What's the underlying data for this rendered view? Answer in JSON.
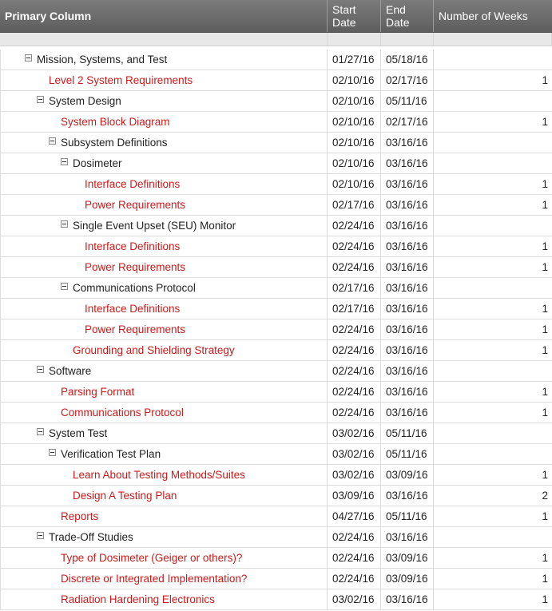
{
  "colors": {
    "task_text": "#cc1a1a",
    "group_text": "#222222",
    "header_bg": "#6b6b6b"
  },
  "header": {
    "primary": "Primary Column",
    "start": "Start\nDate",
    "end": "End\nDate",
    "weeks": "Number of Weeks"
  },
  "rows": [
    {
      "name": "Mission, Systems, and Test",
      "level": 0,
      "group": true,
      "start": "01/27/16",
      "end": "05/18/16",
      "weeks": ""
    },
    {
      "name": "Level 2 System Requirements",
      "level": 1,
      "group": false,
      "start": "02/10/16",
      "end": "02/17/16",
      "weeks": "1"
    },
    {
      "name": "System Design",
      "level": 1,
      "group": true,
      "start": "02/10/16",
      "end": "05/11/16",
      "weeks": ""
    },
    {
      "name": "System Block Diagram",
      "level": 2,
      "group": false,
      "start": "02/10/16",
      "end": "02/17/16",
      "weeks": "1"
    },
    {
      "name": "Subsystem Definitions",
      "level": 2,
      "group": true,
      "start": "02/10/16",
      "end": "03/16/16",
      "weeks": ""
    },
    {
      "name": "Dosimeter",
      "level": 3,
      "group": true,
      "start": "02/10/16",
      "end": "03/16/16",
      "weeks": ""
    },
    {
      "name": "Interface Definitions",
      "level": 4,
      "group": false,
      "start": "02/10/16",
      "end": "03/16/16",
      "weeks": "1"
    },
    {
      "name": "Power Requirements",
      "level": 4,
      "group": false,
      "start": "02/17/16",
      "end": "03/16/16",
      "weeks": "1"
    },
    {
      "name": "Single Event Upset (SEU) Monitor",
      "level": 3,
      "group": true,
      "start": "02/24/16",
      "end": "03/16/16",
      "weeks": ""
    },
    {
      "name": "Interface Definitions",
      "level": 4,
      "group": false,
      "start": "02/24/16",
      "end": "03/16/16",
      "weeks": "1"
    },
    {
      "name": "Power Requirements",
      "level": 4,
      "group": false,
      "start": "02/24/16",
      "end": "03/16/16",
      "weeks": "1"
    },
    {
      "name": "Communications Protocol",
      "level": 3,
      "group": true,
      "start": "02/17/16",
      "end": "03/16/16",
      "weeks": ""
    },
    {
      "name": "Interface Definitions",
      "level": 4,
      "group": false,
      "start": "02/17/16",
      "end": "03/16/16",
      "weeks": "1"
    },
    {
      "name": "Power Requirements",
      "level": 4,
      "group": false,
      "start": "02/24/16",
      "end": "03/16/16",
      "weeks": "1"
    },
    {
      "name": "Grounding and Shielding Strategy",
      "level": 3,
      "group": false,
      "start": "02/24/16",
      "end": "03/16/16",
      "weeks": "1"
    },
    {
      "name": "Software",
      "level": 1,
      "group": true,
      "start": "02/24/16",
      "end": "03/16/16",
      "weeks": ""
    },
    {
      "name": "Parsing Format",
      "level": 2,
      "group": false,
      "start": "02/24/16",
      "end": "03/16/16",
      "weeks": "1"
    },
    {
      "name": "Communications Protocol",
      "level": 2,
      "group": false,
      "start": "02/24/16",
      "end": "03/16/16",
      "weeks": "1"
    },
    {
      "name": "System Test",
      "level": 1,
      "group": true,
      "start": "03/02/16",
      "end": "05/11/16",
      "weeks": ""
    },
    {
      "name": "Verification Test Plan",
      "level": 2,
      "group": true,
      "start": "03/02/16",
      "end": "05/11/16",
      "weeks": ""
    },
    {
      "name": "Learn About Testing Methods/Suites",
      "level": 3,
      "group": false,
      "start": "03/02/16",
      "end": "03/09/16",
      "weeks": "1"
    },
    {
      "name": "Design A Testing Plan",
      "level": 3,
      "group": false,
      "start": "03/09/16",
      "end": "03/16/16",
      "weeks": "2"
    },
    {
      "name": "Reports",
      "level": 2,
      "group": false,
      "start": "04/27/16",
      "end": "05/11/16",
      "weeks": "1"
    },
    {
      "name": "Trade-Off Studies",
      "level": 1,
      "group": true,
      "start": "02/24/16",
      "end": "03/16/16",
      "weeks": ""
    },
    {
      "name": "Type of Dosimeter (Geiger or others)?",
      "level": 2,
      "group": false,
      "start": "02/24/16",
      "end": "03/09/16",
      "weeks": "1"
    },
    {
      "name": "Discrete or Integrated Implementation?",
      "level": 2,
      "group": false,
      "start": "02/24/16",
      "end": "03/09/16",
      "weeks": "1"
    },
    {
      "name": "Radiation Hardening Electronics",
      "level": 2,
      "group": false,
      "start": "03/02/16",
      "end": "03/16/16",
      "weeks": "1"
    }
  ]
}
